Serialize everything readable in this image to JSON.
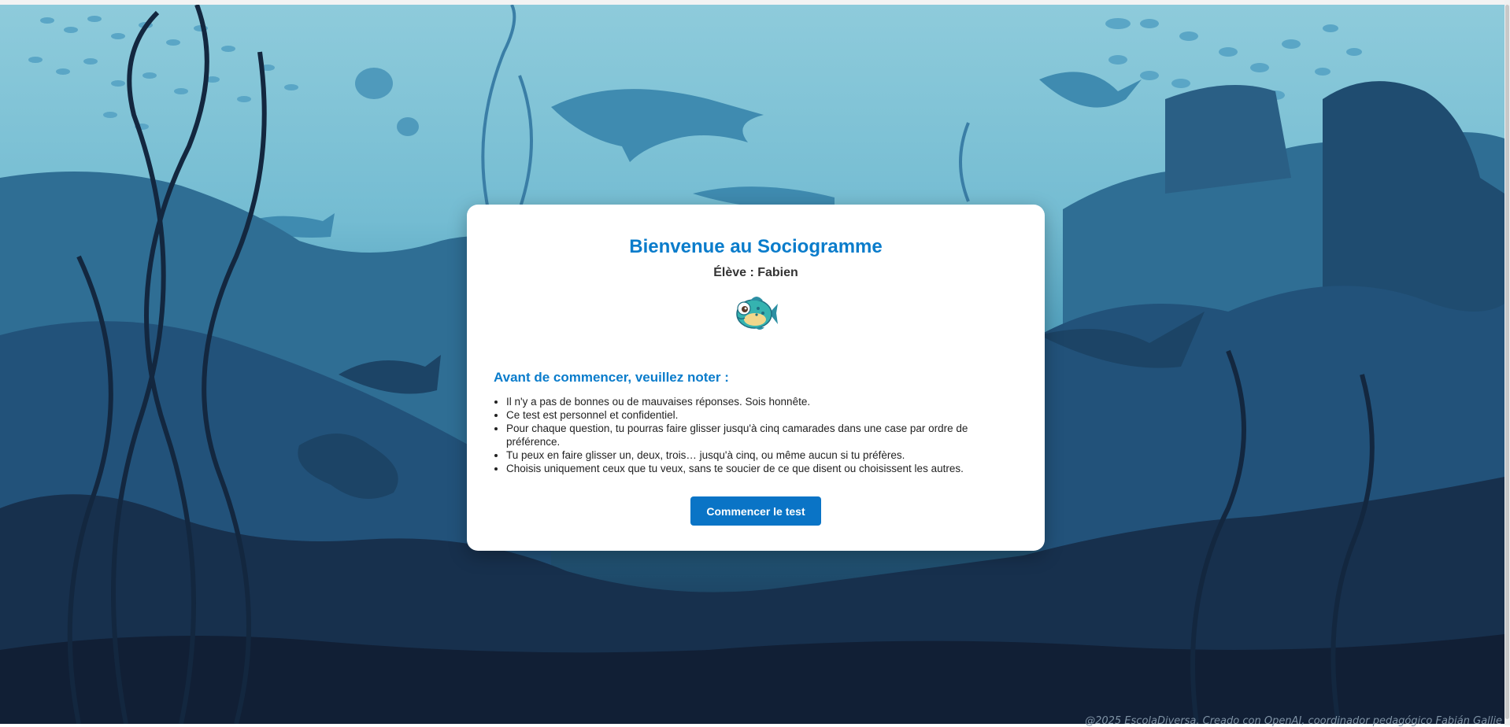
{
  "card": {
    "title": "Bienvenue au Sociogramme",
    "student": "Élève : Fabien",
    "avatar_icon": "cartoon-fish-icon",
    "note_heading": "Avant de commencer, veuillez noter :",
    "rules": [
      "Il n'y a pas de bonnes ou de mauvaises réponses. Sois honnête.",
      "Ce test est personnel et confidentiel.",
      "Pour chaque question, tu pourras faire glisser jusqu'à cinq camarades dans une case par ordre de préférence.",
      "Tu peux en faire glisser un, deux, trois… jusqu'à cinq, ou même aucun si tu préfères.",
      "Choisis uniquement ceux que tu veux, sans te soucier de ce que disent ou choisissent les autres."
    ],
    "start_button": "Commencer le test"
  },
  "footer": "@2025 EscolaDiversa. Creado con OpenAI, coordinador pedagógico Fabián Gallie",
  "colors": {
    "accent": "#0a7ccb",
    "button": "#0a74c6",
    "sea_light": "#8ecbdb",
    "sea_dark": "#142640"
  }
}
